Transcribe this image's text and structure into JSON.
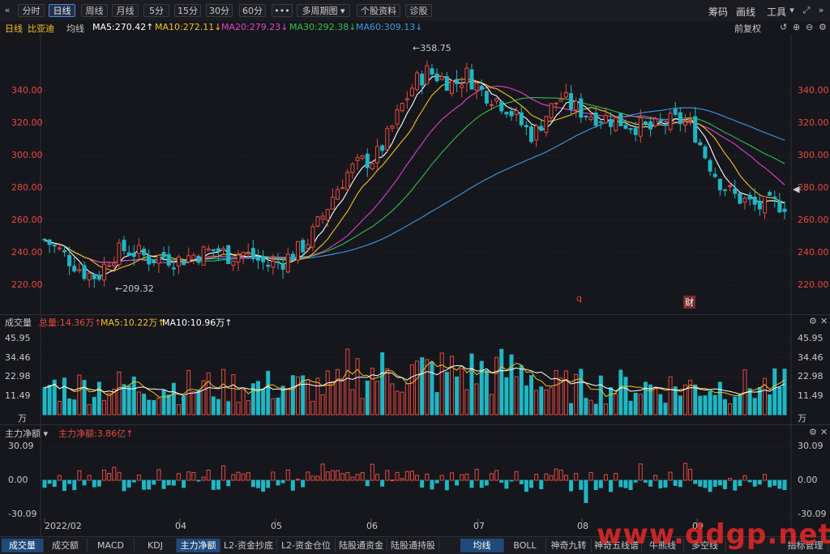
{
  "toolbar": {
    "collapse_icon": "«",
    "periods": [
      "分时",
      "日线",
      "周线",
      "月线",
      "5分",
      "15分",
      "30分",
      "60分"
    ],
    "active_period": "日线",
    "more_label": "•••",
    "multi_period_label": "多周期图",
    "profile_label": "个股资料",
    "diagnose_label": "诊股",
    "right_chips": "筹码",
    "right_draw": "画线",
    "right_tools": "工具"
  },
  "ma_bar": {
    "period": "日线",
    "stock_name": "比亚迪",
    "ma_label": "均线",
    "ma5": "MA5:270.42↑",
    "ma10": "MA10:272.11↓",
    "ma20": "MA20:279.23↓",
    "ma30": "MA30:292.38↓",
    "ma60": "MA60:309.13↓",
    "adjust": "前复权"
  },
  "price_axis": {
    "ticks": [
      "340.00",
      "320.00",
      "300.00",
      "280.00",
      "260.00",
      "240.00",
      "220.00"
    ],
    "high_label": "358.75",
    "low_label": "209.32",
    "markers": [
      "q",
      "财"
    ]
  },
  "volume_panel": {
    "title": "成交量",
    "total": "总量:14.36万↑",
    "ma5": "MA5:10.22万↑",
    "ma10": "MA10:10.96万↑",
    "ticks": [
      "45.95",
      "34.46",
      "22.98",
      "11.49"
    ],
    "unit": "万"
  },
  "fund_panel": {
    "title": "主力净额 ▾",
    "value": "主力净额:3.86亿↑",
    "ticks": [
      "30.09",
      "0.00",
      "-30.09"
    ]
  },
  "date_axis": [
    "2022/02",
    "04",
    "05",
    "06",
    "07",
    "08",
    "09"
  ],
  "bottom_tabs_left": [
    "成交量",
    "成交额",
    "MACD",
    "KDJ",
    "主力净额",
    "L2-资金抄底",
    "L2-资金仓位",
    "陆股通资金",
    "陆股通持股"
  ],
  "bottom_tabs_right": [
    "均线",
    "BOLL",
    "神奇九转",
    "神奇五线谱",
    "牛熊线",
    "多空线",
    "指标管理"
  ],
  "watermark": "www.ddgp.net",
  "colors": {
    "up": "#e8493f",
    "down": "#1fb7c4",
    "ma5": "#ffffff",
    "ma10": "#f2c21a",
    "ma20": "#e040c8",
    "ma30": "#2fbf4a",
    "ma60": "#3b9ae8"
  },
  "chart_data": {
    "type": "candlestick",
    "price_range": [
      205,
      365
    ],
    "close_path_summary": [
      248,
      242,
      235,
      228,
      225,
      238,
      242,
      240,
      236,
      238,
      235,
      238,
      240,
      242,
      238,
      240,
      236,
      232,
      235,
      240,
      248,
      262,
      278,
      290,
      296,
      298,
      312,
      330,
      345,
      352,
      348,
      344,
      350,
      340,
      336,
      330,
      320,
      312,
      326,
      336,
      330,
      326,
      324,
      322,
      320,
      318,
      316,
      320,
      322,
      318,
      300,
      285,
      276,
      272,
      268,
      270,
      270
    ]
  }
}
